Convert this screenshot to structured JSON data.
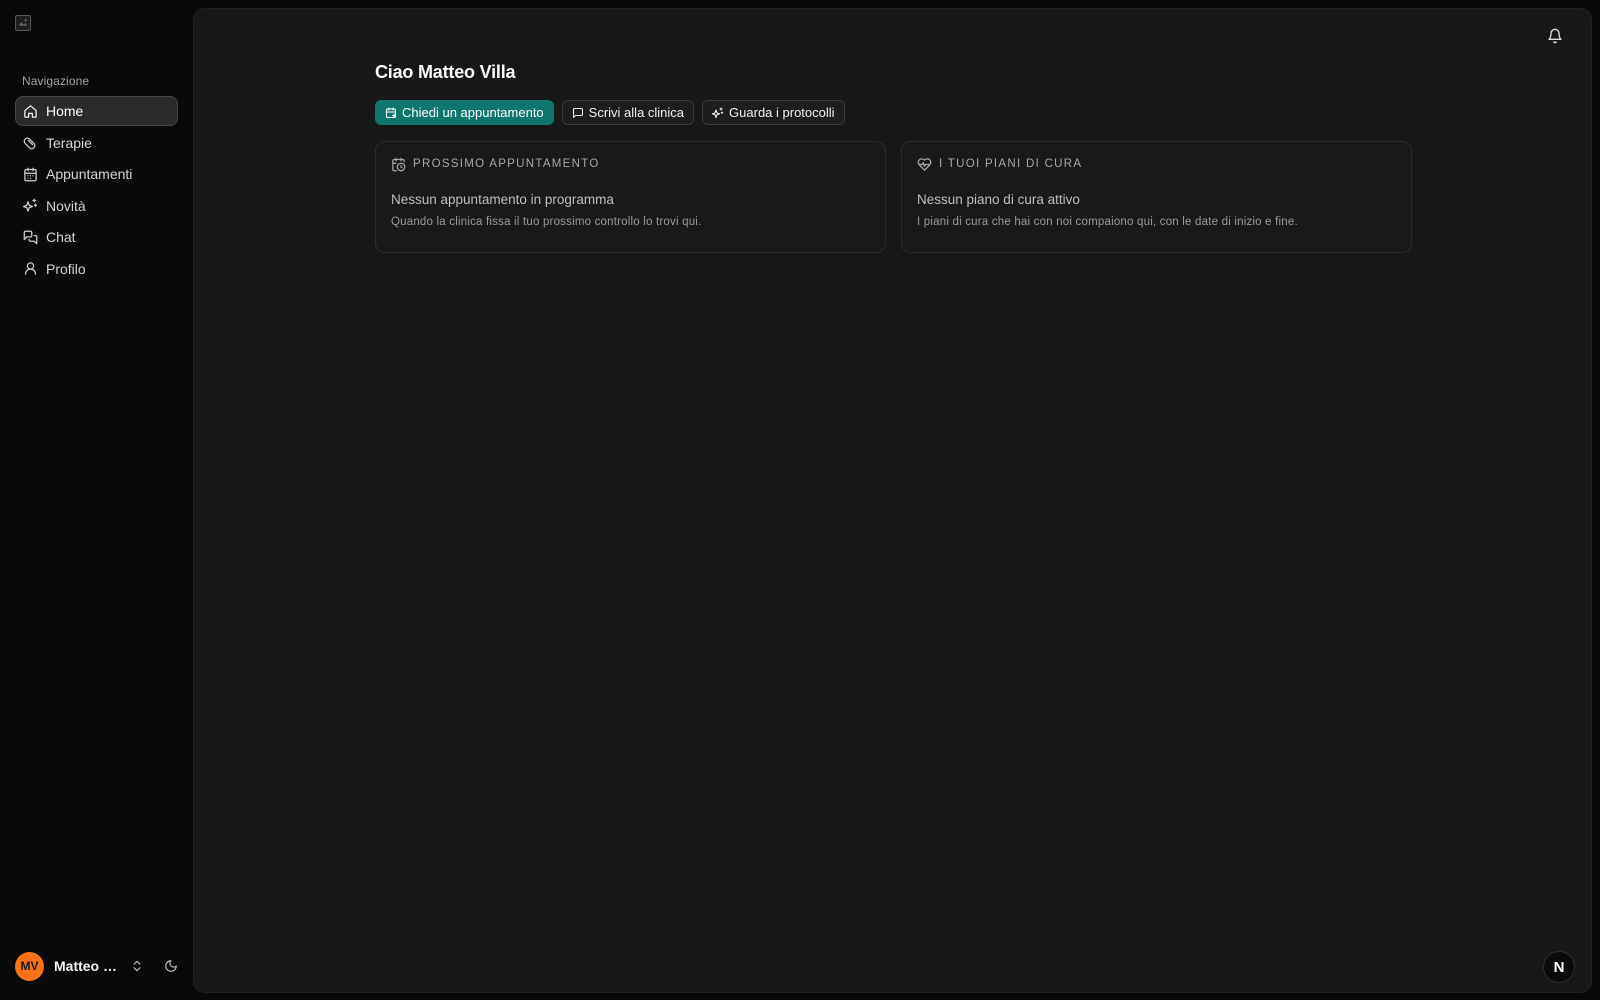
{
  "sidebar": {
    "heading": "Navigazione",
    "items": [
      {
        "label": "Home",
        "icon": "home-icon",
        "active": true
      },
      {
        "label": "Terapie",
        "icon": "pill-icon"
      },
      {
        "label": "Appuntamenti",
        "icon": "calendar-icon"
      },
      {
        "label": "Novità",
        "icon": "sparkles-icon"
      },
      {
        "label": "Chat",
        "icon": "chat-icon"
      },
      {
        "label": "Profilo",
        "icon": "user-icon"
      }
    ],
    "user": {
      "initials": "MV",
      "name": "Matteo V..."
    }
  },
  "main": {
    "title": "Ciao Matteo Villa",
    "actions": {
      "primary": "Chiedi un appuntamento",
      "message": "Scrivi alla clinica",
      "protocols": "Guarda i protocolli"
    },
    "cards": {
      "appointment": {
        "label": "PROSSIMO APPUNTAMENTO",
        "title": "Nessun appuntamento in programma",
        "subtitle": "Quando la clinica fissa il tuo prossimo controllo lo trovi qui."
      },
      "care": {
        "label": "I TUOI PIANI DI CURA",
        "title": "Nessun piano di cura attivo",
        "subtitle": "I piani di cura che hai con noi compaiono qui, con le date di inizio e fine."
      }
    },
    "badge": "N"
  },
  "colors": {
    "accent": "#0f766e",
    "avatar": "#f97316",
    "panel": "#181818",
    "sidebar": "#0a0a0a"
  }
}
